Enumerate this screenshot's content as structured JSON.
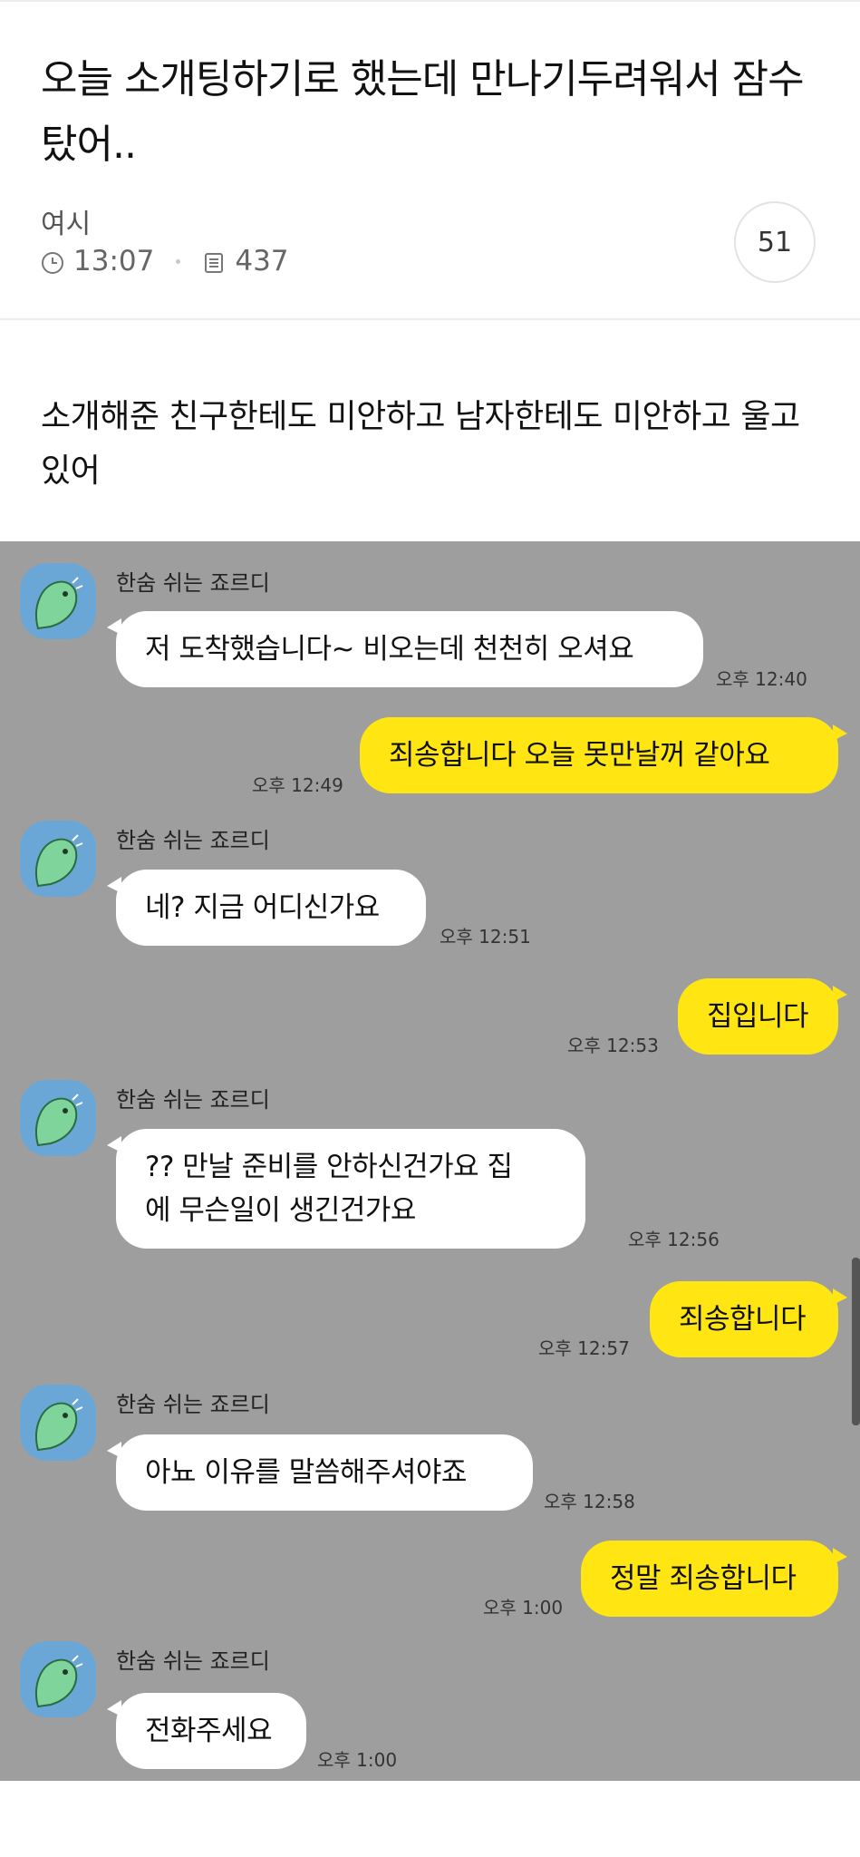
{
  "post": {
    "title": "오늘 소개팅하기로 했는데 만나기두려워서 잠수 탔어..",
    "author": "여시",
    "time": "13:07",
    "views": "437",
    "comment_count": "51",
    "body": "소개해준 친구한테도 미안하고 남자한테도 미안하고 울고있어"
  },
  "chat": {
    "sender_name": "한숨 쉬는 죠르디",
    "messages": [
      {
        "side": "in",
        "text": "저 도착했습니다~ 비오는데 천천히 오셔요",
        "time": "오후 12:40"
      },
      {
        "side": "out",
        "text": "죄송합니다 오늘 못만날꺼 같아요",
        "time": "오후 12:49"
      },
      {
        "side": "in",
        "text": "네? 지금 어디신가요",
        "time": "오후 12:51"
      },
      {
        "side": "out",
        "text": "집입니다",
        "time": "오후 12:53"
      },
      {
        "side": "in",
        "text": "?? 만날 준비를 안하신건가요 집에 무슨일이 생긴건가요",
        "time": "오후 12:56"
      },
      {
        "side": "out",
        "text": "죄송합니다",
        "time": "오후 12:57"
      },
      {
        "side": "in",
        "text": "아뇨 이유를 말씀해주셔야죠",
        "time": "오후 12:58"
      },
      {
        "side": "out",
        "text": "정말 죄송합니다",
        "time": "오후 1:00"
      },
      {
        "side": "in",
        "text": "전화주세요",
        "time": "오후 1:00"
      }
    ]
  },
  "colors": {
    "chat_bg": "#9e9e9e",
    "outgoing_bubble": "#ffe612",
    "incoming_bubble": "#ffffff",
    "avatar_bg": "#6aa7d7"
  },
  "icons": {
    "clock": "clock-icon",
    "views": "document-icon",
    "avatar": "jordy-dinosaur-icon"
  }
}
